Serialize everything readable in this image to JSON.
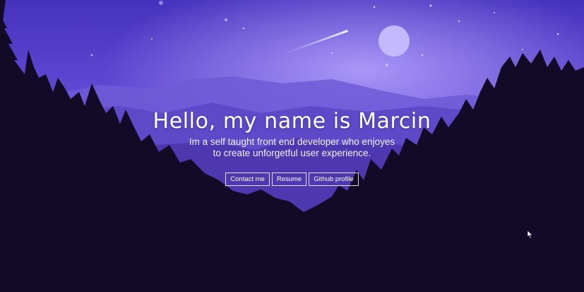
{
  "hero": {
    "title": "Hello, my name is Marcin",
    "subtitle": "Im a self taught front end developer who enjoyes to create unforgetful user experience."
  },
  "buttons": {
    "contact": "Contact me",
    "resume": "Resume",
    "github": "Github profile"
  },
  "colors": {
    "sky_top": "#4a35c2",
    "sky_glow": "#9a86f2",
    "mountain": "#6f5bd8",
    "forest": "#120a26"
  },
  "icons": [
    "moon-icon",
    "shooting-star-icon",
    "mouse-cursor-icon"
  ]
}
